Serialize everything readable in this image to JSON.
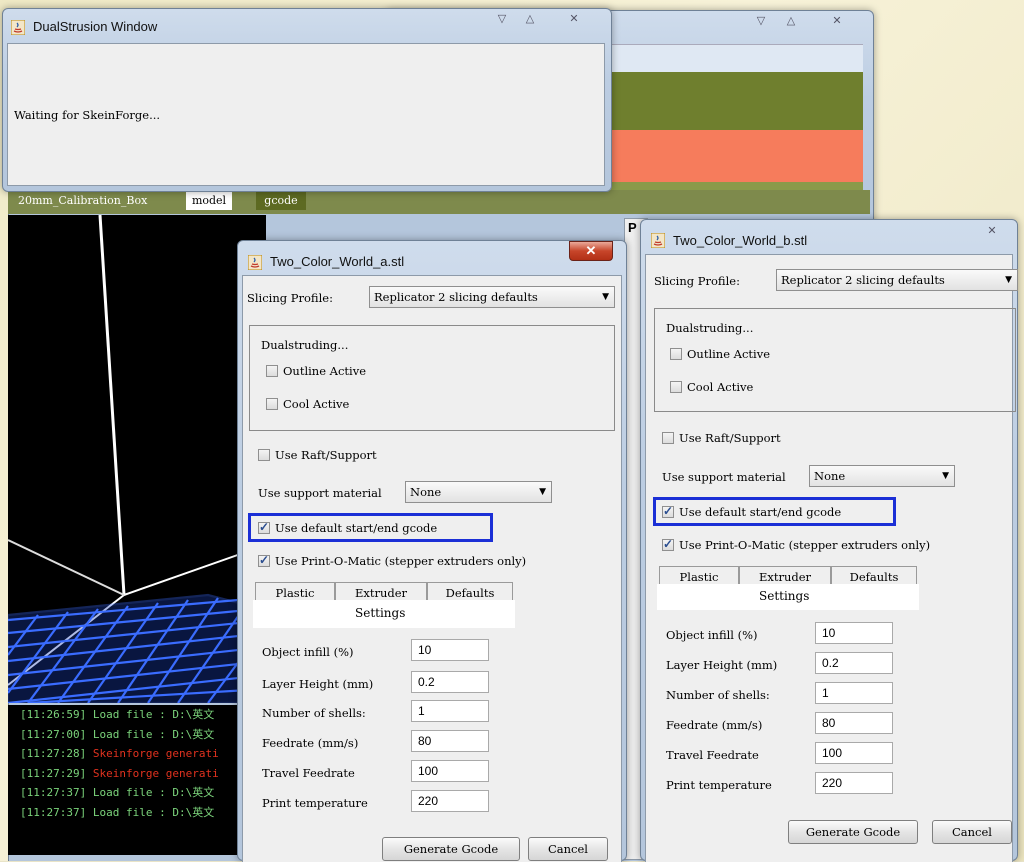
{
  "dualstrusion": {
    "title": "DualStrusion Window",
    "message": "Waiting for SkeinForge..."
  },
  "main_window": {
    "tabs": [
      "20mm_Calibration_Box",
      "model",
      "gcode"
    ],
    "console": [
      {
        "time": "[11:26:59]",
        "text": "Load file : D:\\英文",
        "color": "#7bd37b"
      },
      {
        "time": "[11:27:00]",
        "text": "Load file : D:\\英文",
        "color": "#7bd37b"
      },
      {
        "time": "[11:27:28]",
        "text": "Skeinforge generati",
        "color": "#e0321f"
      },
      {
        "time": "[11:27:29]",
        "text": "Skeinforge generati",
        "color": "#e0321f"
      },
      {
        "time": "[11:27:37]",
        "text": "Load file : D:\\英文",
        "color": "#7bd37b"
      },
      {
        "time": "[11:27:37]",
        "text": "Load file : D:\\英文",
        "color": "#7bd37b"
      }
    ]
  },
  "dialog_a": {
    "title": "Two_Color_World_a.stl",
    "slicing_profile_label": "Slicing Profile:",
    "slicing_profile_value": "Replicator 2 slicing defaults",
    "dualstruding_label": "Dualstruding...",
    "outline_active": "Outline Active",
    "cool_active": "Cool Active",
    "use_raft": "Use Raft/Support",
    "support_material_label": "Use support material",
    "support_material_value": "None",
    "use_default_gcode": "Use default start/end gcode",
    "use_print_o_matic": "Use Print-O-Matic (stepper extruders only)",
    "tabs": [
      "Plastic",
      "Extruder",
      "Defaults"
    ],
    "settings_title": "Settings",
    "settings": [
      {
        "label": "Object infill (%)",
        "value": "10"
      },
      {
        "label": "Layer Height (mm)",
        "value": "0.2"
      },
      {
        "label": "Number of shells:",
        "value": "1"
      },
      {
        "label": "Feedrate (mm/s)",
        "value": "80"
      },
      {
        "label": "Travel Feedrate",
        "value": "100"
      },
      {
        "label": "Print temperature",
        "value": "220"
      }
    ],
    "generate_label": "Generate Gcode",
    "cancel_label": "Cancel"
  },
  "dialog_b": {
    "title": "Two_Color_World_b.stl",
    "slicing_profile_label": "Slicing Profile:",
    "slicing_profile_value": "Replicator 2 slicing defaults",
    "dualstruding_label": "Dualstruding...",
    "outline_active": "Outline Active",
    "cool_active": "Cool Active",
    "use_raft": "Use Raft/Support",
    "support_material_label": "Use support material",
    "support_material_value": "None",
    "use_default_gcode": "Use default start/end gcode",
    "use_print_o_matic": "Use Print-O-Matic (stepper extruders only)",
    "tabs": [
      "Plastic",
      "Extruder",
      "Defaults"
    ],
    "settings_title": "Settings",
    "settings": [
      {
        "label": "Object infill (%)",
        "value": "10"
      },
      {
        "label": "Layer Height (mm)",
        "value": "0.2"
      },
      {
        "label": "Number of shells:",
        "value": "1"
      },
      {
        "label": "Feedrate (mm/s)",
        "value": "80"
      },
      {
        "label": "Travel Feedrate",
        "value": "100"
      },
      {
        "label": "Print temperature",
        "value": "220"
      }
    ],
    "generate_label": "Generate Gcode",
    "cancel_label": "Cancel"
  },
  "colors": {
    "olive_strip": "#6f7f2e",
    "salmon_strip": "#f67c5c",
    "highlight": "#1b2fd6",
    "grid": "#3a6cff"
  }
}
